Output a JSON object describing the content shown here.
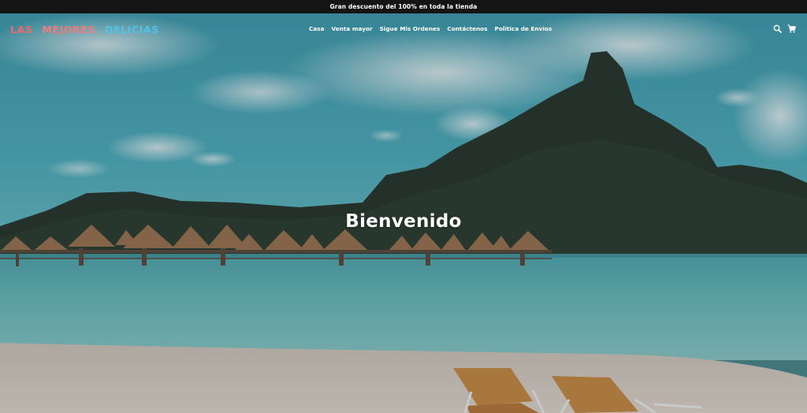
{
  "announcement": {
    "text": "Gran descuento del 100% en toda la tienda"
  },
  "logo": {
    "word1": "LAS",
    "word2": "MEJORES",
    "word3": "DELICIAS"
  },
  "nav": {
    "items": [
      {
        "label": "Casa"
      },
      {
        "label": "Venta mayor"
      },
      {
        "label": "Sigue Mis Ordenes"
      },
      {
        "label": "Contáctenos"
      },
      {
        "label": "Politica de Envios"
      }
    ]
  },
  "header_icons": [
    "search-icon",
    "cart-icon"
  ],
  "hero": {
    "title": "Bienvenido"
  },
  "colors": {
    "announcement_bg": "#141414",
    "logo_red": "#f06b6b",
    "logo_blue": "#4fc3e8",
    "sky": "#4aa8b8",
    "sea": "#62b6b6",
    "sand": "#d9cfc4"
  }
}
